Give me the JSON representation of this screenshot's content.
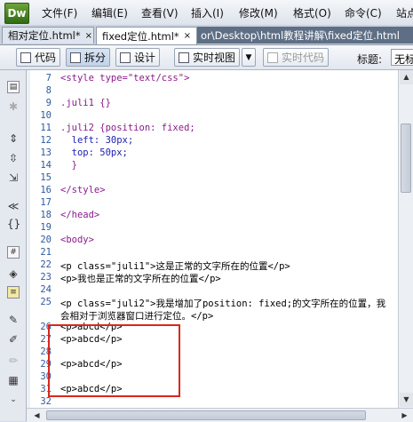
{
  "app": {
    "logo": "Dw"
  },
  "menu": [
    {
      "label": "文件(F)"
    },
    {
      "label": "编辑(E)"
    },
    {
      "label": "查看(V)"
    },
    {
      "label": "插入(I)"
    },
    {
      "label": "修改(M)"
    },
    {
      "label": "格式(O)"
    },
    {
      "label": "命令(C)"
    },
    {
      "label": "站点"
    }
  ],
  "tabs": [
    {
      "label": "相对定位.html*",
      "close": "×"
    },
    {
      "label": "fixed定位.html*",
      "close": "×"
    }
  ],
  "path": "or\\Desktop\\html教程讲解\\fixed定位.html",
  "toolbar": {
    "code": "代码",
    "split": "拆分",
    "design": "设计",
    "live_view": "实时视图",
    "live_code": "实时代码",
    "title_label": "标题:",
    "title_value": "无标"
  },
  "line_numbers": [
    "7",
    "8",
    "9",
    "10",
    "11",
    "12",
    "13",
    "14",
    "15",
    "16",
    "17",
    "18",
    "19",
    "20",
    "21",
    "22",
    "23",
    "24",
    "25",
    "",
    "26",
    "27",
    "28",
    "29",
    "30",
    "31",
    "32"
  ],
  "code_lines": [
    "<style type=\"text/css\">",
    "",
    ".juli1 {}",
    "",
    ".juli2 {position: fixed;",
    "  left: 30px;",
    "  top: 50px;",
    "  }",
    "",
    "</style>",
    "",
    "</head>",
    "",
    "<body>",
    "",
    "<p class=\"juli1\">这是正常的文字所在的位置</p>",
    "<p>我也是正常的文字所在的位置</p>",
    "",
    "<p class=\"juli2\">我是增加了position: fixed;的文字所在的位置，我",
    "会相对于浏览器窗口进行定位。</p>",
    "<p>abcd</p>",
    "<p>abcd</p>",
    "",
    "<p>abcd</p>",
    "",
    "<p>abcd</p>",
    ""
  ]
}
